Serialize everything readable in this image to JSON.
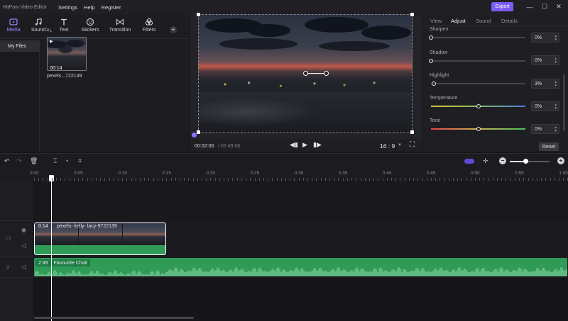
{
  "app": {
    "title": "HitPaw Video Editor"
  },
  "menu": [
    "Settings",
    "Help",
    "Register"
  ],
  "export_label": "Export",
  "window_buttons": {
    "minimize": "—",
    "maximize": "☐",
    "close": "✕"
  },
  "toolbar": [
    {
      "label": "Media",
      "icon": "media-icon",
      "active": true
    },
    {
      "label": "Sound",
      "icon": "music-note-icon",
      "active": false
    },
    {
      "label": "Text",
      "icon": "text-icon",
      "active": false
    },
    {
      "label": "Stickers",
      "icon": "sticker-icon",
      "active": false
    },
    {
      "label": "Transition",
      "icon": "transition-icon",
      "active": false
    },
    {
      "label": "Filters",
      "icon": "filters-icon",
      "active": false
    }
  ],
  "library": {
    "folder": "My Files",
    "sort_icon": "≡↓",
    "add_icon": "+",
    "item": {
      "duration": "00:14",
      "name": "pexels...722139"
    }
  },
  "preview": {
    "time_current": "00:02:00",
    "time_total": "/ 02:49:08",
    "ratio": "16 : 9",
    "prev_glyph": "◀▮",
    "play_glyph": "▶",
    "next_glyph": "▮▶",
    "fullscreen_glyph": "⛶"
  },
  "right_tabs": [
    {
      "label": "View",
      "active": false
    },
    {
      "label": "Adjust",
      "active": true
    },
    {
      "label": "Sound",
      "active": false
    },
    {
      "label": "Details",
      "active": false
    }
  ],
  "adjust": {
    "sliders": [
      {
        "label": "Sharpen",
        "value": "0%",
        "level": 0.0
      },
      {
        "label": "Shadow",
        "value": "0%",
        "level": 0.0
      },
      {
        "label": "Highlight",
        "value": "3%",
        "level": 0.03
      },
      {
        "label": "Temperature",
        "value": "0%",
        "level": 0.5
      },
      {
        "label": "Tone",
        "value": "0%",
        "level": 0.5
      }
    ],
    "reset_label": "Reset",
    "colors": {
      "temperature_from": "#e0c040",
      "temperature_to": "#4a7de8",
      "tone_from": "#e04848",
      "tone_to": "#48c060"
    }
  },
  "timeline": {
    "ruler": [
      "0:00",
      "0:05",
      "0:10",
      "0:15",
      "0:20",
      "0:25",
      "0:30",
      "0:35",
      "0:40",
      "0:45",
      "0:50",
      "0:55",
      "1:00"
    ],
    "video_clip": {
      "duration": "0:14",
      "name": "pexels- kelly- lacy-9722139"
    },
    "audio_clip": {
      "duration": "2:49",
      "name": "Favourite Chair"
    },
    "zoom_minus": "−",
    "zoom_plus": "+",
    "zoom_level": 0.4
  },
  "colors": {
    "accent": "#7b5cf5",
    "clip_green": "#2f9b57",
    "background": "#161619"
  }
}
